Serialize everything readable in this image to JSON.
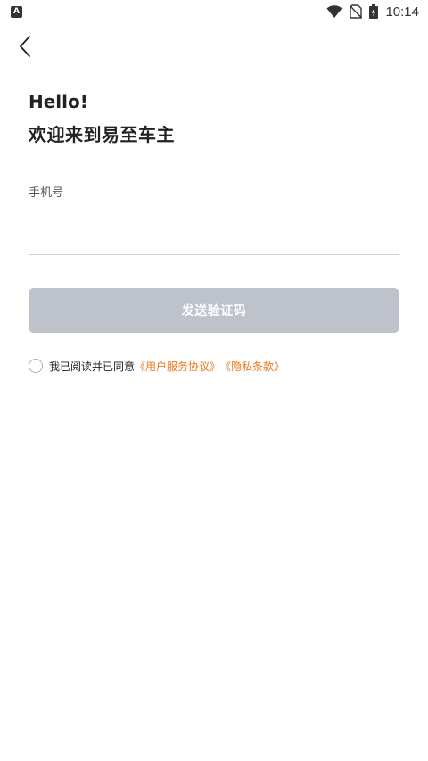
{
  "status_bar": {
    "app_badge": "A",
    "time": "10:14"
  },
  "greeting": {
    "hello": "Hello!",
    "welcome": "欢迎来到易至车主"
  },
  "phone": {
    "label": "手机号",
    "value": "",
    "placeholder": ""
  },
  "send_code_button": {
    "label": "发送验证码",
    "color": "#bec3cb"
  },
  "agreement": {
    "prefix": "我已阅读并已同意",
    "user_agreement": "《用户服务协议》",
    "privacy_policy": "《隐私条款》",
    "link_color": "#e8791f",
    "checked": false
  }
}
